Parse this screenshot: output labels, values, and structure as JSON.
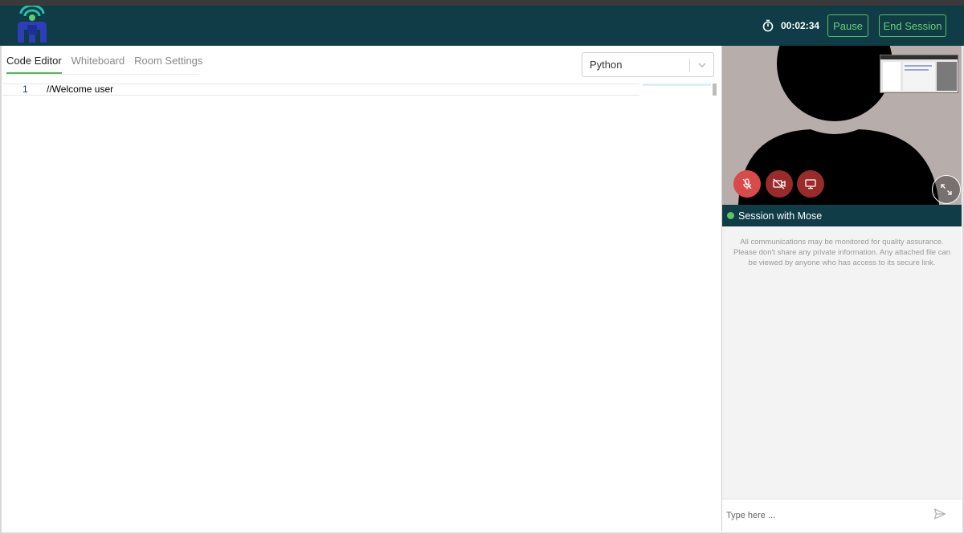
{
  "header": {
    "timer": "00:02:34",
    "pause_label": "Pause",
    "end_session_label": "End Session",
    "colors": {
      "bar": "#0f3c46",
      "accent": "#58c15b"
    }
  },
  "tabs": [
    {
      "label": "Code Editor",
      "active": true
    },
    {
      "label": "Whiteboard",
      "active": false
    },
    {
      "label": "Room Settings",
      "active": false
    }
  ],
  "language_select": {
    "value": "Python",
    "icon": "chevron-down-icon"
  },
  "editor": {
    "lines": [
      {
        "number": "1",
        "text": "//Welcome user"
      }
    ]
  },
  "video": {
    "controls": [
      "mic-off-icon",
      "camera-off-icon",
      "screen-share-icon"
    ],
    "expand_icon": "expand-icon"
  },
  "session": {
    "title": "Session with Mose",
    "status_color": "#5fc35f"
  },
  "chat": {
    "notice": "All communications may be monitored for quality assurance. Please don't share any private information. Any attached file can be viewed by anyone who has access to its secure link.",
    "input_placeholder": "Type here ...",
    "send_icon": "send-icon"
  }
}
